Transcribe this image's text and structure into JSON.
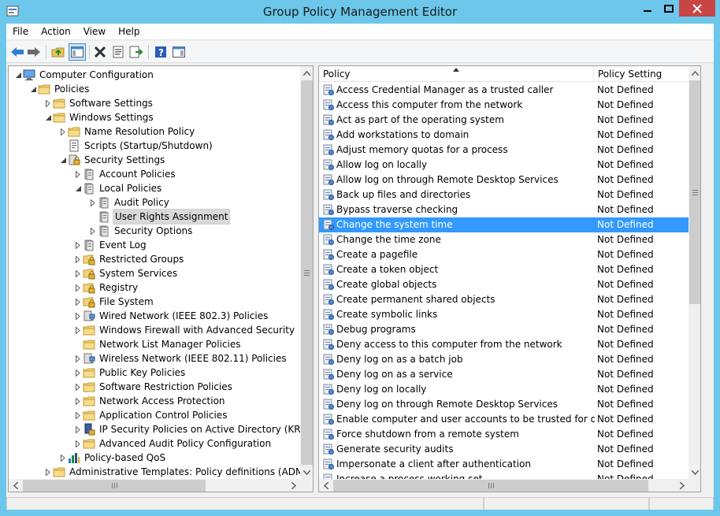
{
  "window": {
    "title": "Group Policy Management Editor"
  },
  "menu": [
    "File",
    "Action",
    "View",
    "Help"
  ],
  "toolbar": [
    "back-icon",
    "forward-icon",
    "up-folder-icon",
    "show-hide-tree-icon",
    "delete-icon",
    "properties-icon",
    "export-list-icon",
    "help-icon",
    "show-action-pane-icon"
  ],
  "tree": [
    {
      "label": "Computer Configuration",
      "level": 0,
      "exp": "open",
      "icon": "computer-icon"
    },
    {
      "label": "Policies",
      "level": 1,
      "exp": "open",
      "icon": "folder-icon"
    },
    {
      "label": "Software Settings",
      "level": 2,
      "exp": "closed",
      "icon": "folder-icon"
    },
    {
      "label": "Windows Settings",
      "level": 2,
      "exp": "open",
      "icon": "folder-icon"
    },
    {
      "label": "Name Resolution Policy",
      "level": 3,
      "exp": "closed",
      "icon": "folder-icon"
    },
    {
      "label": "Scripts (Startup/Shutdown)",
      "level": 3,
      "exp": "none",
      "icon": "script-icon"
    },
    {
      "label": "Security Settings",
      "level": 3,
      "exp": "open",
      "icon": "security-icon"
    },
    {
      "label": "Account Policies",
      "level": 4,
      "exp": "closed",
      "icon": "policy-book-icon"
    },
    {
      "label": "Local Policies",
      "level": 4,
      "exp": "open",
      "icon": "policy-book-icon"
    },
    {
      "label": "Audit Policy",
      "level": 5,
      "exp": "closed",
      "icon": "policy-book-icon"
    },
    {
      "label": "User Rights Assignment",
      "level": 5,
      "exp": "none",
      "icon": "policy-book-icon",
      "selected": true
    },
    {
      "label": "Security Options",
      "level": 5,
      "exp": "closed",
      "icon": "policy-book-icon"
    },
    {
      "label": "Event Log",
      "level": 4,
      "exp": "closed",
      "icon": "policy-book-icon"
    },
    {
      "label": "Restricted Groups",
      "level": 4,
      "exp": "closed",
      "icon": "lock-folder-icon"
    },
    {
      "label": "System Services",
      "level": 4,
      "exp": "closed",
      "icon": "lock-folder-icon"
    },
    {
      "label": "Registry",
      "level": 4,
      "exp": "closed",
      "icon": "lock-folder-icon"
    },
    {
      "label": "File System",
      "level": 4,
      "exp": "closed",
      "icon": "lock-folder-icon"
    },
    {
      "label": "Wired Network (IEEE 802.3) Policies",
      "level": 4,
      "exp": "closed",
      "icon": "network-policy-icon"
    },
    {
      "label": "Windows Firewall with Advanced Security",
      "level": 4,
      "exp": "closed",
      "icon": "folder-icon"
    },
    {
      "label": "Network List Manager Policies",
      "level": 4,
      "exp": "none",
      "icon": "folder-icon"
    },
    {
      "label": "Wireless Network (IEEE 802.11) Policies",
      "level": 4,
      "exp": "closed",
      "icon": "network-policy-icon"
    },
    {
      "label": "Public Key Policies",
      "level": 4,
      "exp": "closed",
      "icon": "folder-icon"
    },
    {
      "label": "Software Restriction Policies",
      "level": 4,
      "exp": "closed",
      "icon": "folder-icon"
    },
    {
      "label": "Network Access Protection",
      "level": 4,
      "exp": "closed",
      "icon": "folder-icon"
    },
    {
      "label": "Application Control Policies",
      "level": 4,
      "exp": "closed",
      "icon": "folder-icon"
    },
    {
      "label": "IP Security Policies on Active Directory (KRIEFLT",
      "level": 4,
      "exp": "closed",
      "icon": "ip-security-icon"
    },
    {
      "label": "Advanced Audit Policy Configuration",
      "level": 4,
      "exp": "closed",
      "icon": "folder-icon"
    },
    {
      "label": "Policy-based QoS",
      "level": 3,
      "exp": "closed",
      "icon": "qos-chart-icon"
    },
    {
      "label": "Administrative Templates: Policy definitions (ADMX file",
      "level": 2,
      "exp": "closed",
      "icon": "folder-icon"
    }
  ],
  "list": {
    "columns": [
      "Policy",
      "Policy Setting"
    ],
    "rows": [
      {
        "policy": "Access Credential Manager as a trusted caller",
        "setting": "Not Defined"
      },
      {
        "policy": "Access this computer from the network",
        "setting": "Not Defined"
      },
      {
        "policy": "Act as part of the operating system",
        "setting": "Not Defined"
      },
      {
        "policy": "Add workstations to domain",
        "setting": "Not Defined"
      },
      {
        "policy": "Adjust memory quotas for a process",
        "setting": "Not Defined"
      },
      {
        "policy": "Allow log on locally",
        "setting": "Not Defined"
      },
      {
        "policy": "Allow log on through Remote Desktop Services",
        "setting": "Not Defined"
      },
      {
        "policy": "Back up files and directories",
        "setting": "Not Defined"
      },
      {
        "policy": "Bypass traverse checking",
        "setting": "Not Defined"
      },
      {
        "policy": "Change the system time",
        "setting": "Not Defined",
        "selected": true
      },
      {
        "policy": "Change the time zone",
        "setting": "Not Defined"
      },
      {
        "policy": "Create a pagefile",
        "setting": "Not Defined"
      },
      {
        "policy": "Create a token object",
        "setting": "Not Defined"
      },
      {
        "policy": "Create global objects",
        "setting": "Not Defined"
      },
      {
        "policy": "Create permanent shared objects",
        "setting": "Not Defined"
      },
      {
        "policy": "Create symbolic links",
        "setting": "Not Defined"
      },
      {
        "policy": "Debug programs",
        "setting": "Not Defined"
      },
      {
        "policy": "Deny access to this computer from the network",
        "setting": "Not Defined"
      },
      {
        "policy": "Deny log on as a batch job",
        "setting": "Not Defined"
      },
      {
        "policy": "Deny log on as a service",
        "setting": "Not Defined"
      },
      {
        "policy": "Deny log on locally",
        "setting": "Not Defined"
      },
      {
        "policy": "Deny log on through Remote Desktop Services",
        "setting": "Not Defined"
      },
      {
        "policy": "Enable computer and user accounts to be trusted for delega...",
        "setting": "Not Defined"
      },
      {
        "policy": "Force shutdown from a remote system",
        "setting": "Not Defined"
      },
      {
        "policy": "Generate security audits",
        "setting": "Not Defined"
      },
      {
        "policy": "Impersonate a client after authentication",
        "setting": "Not Defined"
      },
      {
        "policy": "Increase a process working set",
        "setting": "Not Defined"
      }
    ]
  },
  "colors": {
    "accent": "#3399ff",
    "titlebar": "#6cc7ea",
    "close": "#c74545"
  }
}
